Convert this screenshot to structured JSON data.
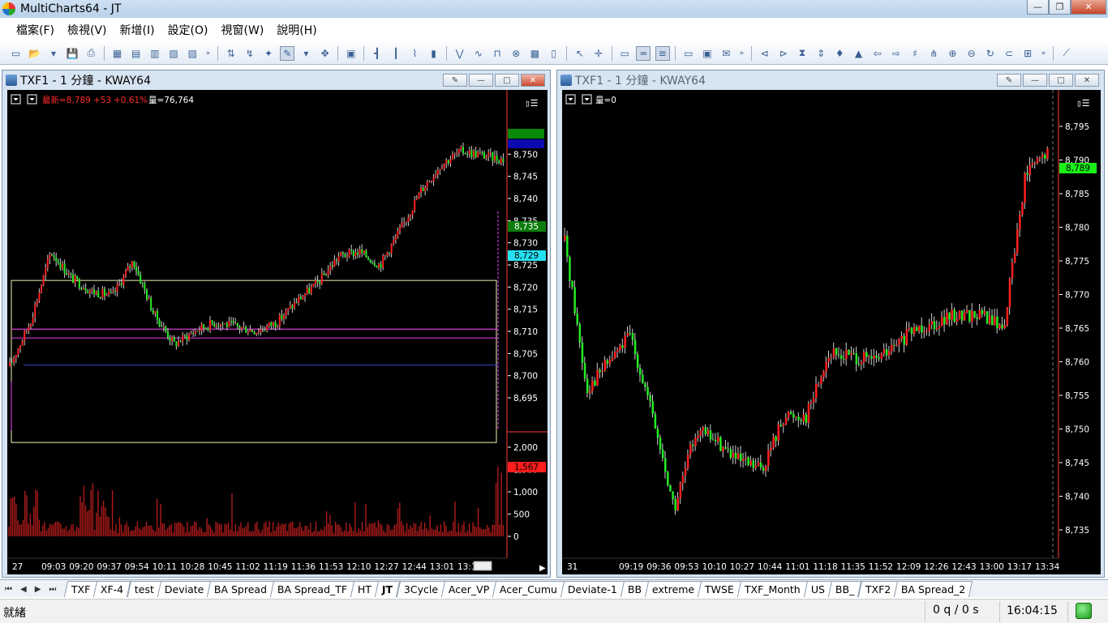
{
  "window": {
    "title": "MultiCharts64 - JT"
  },
  "menu": [
    "檔案(F)",
    "檢視(V)",
    "新增(I)",
    "設定(O)",
    "視窗(W)",
    "說明(H)"
  ],
  "colors": {
    "up": "#ff2020",
    "down": "#22ee22",
    "bg": "#000000",
    "axis_text": "#ffffff",
    "volume": "#b01b1b"
  },
  "left_chart": {
    "title": "TXF1 - 1 分鐘 - KWAY64",
    "status_label": "最新=8,789",
    "status_change": "+53",
    "status_pct": "+0.61%",
    "status_volume": "量=76,764",
    "price_ticks": [
      "8,755",
      "8,750",
      "8,745",
      "8,740",
      "8,735",
      "8,730",
      "8,725",
      "8,720",
      "8,715",
      "8,710",
      "8,705",
      "8,700",
      "8,695"
    ],
    "volume_ticks": [
      "2,000",
      "1,500",
      "1,000",
      "500",
      "0"
    ],
    "time_ticks": [
      "27",
      "09:03",
      "09:20",
      "09:37",
      "09:54",
      "10:11",
      "10:28",
      "10:45",
      "11:02",
      "11:19",
      "11:36",
      "11:53",
      "12:10",
      "12:27",
      "12:44",
      "13:01",
      "13:18"
    ],
    "tags": {
      "green": "8,735",
      "cyan": "8,729",
      "volume": "1,567"
    }
  },
  "right_chart": {
    "title": "TXF1 - 1 分鐘 - KWAY64",
    "status_volume": "量=0",
    "price_ticks": [
      "8,795",
      "8,790",
      "8,785",
      "8,780",
      "8,775",
      "8,770",
      "8,765",
      "8,760",
      "8,755",
      "8,750",
      "8,745",
      "8,740",
      "8,735"
    ],
    "time_ticks": [
      "31",
      "09:19",
      "09:36",
      "09:53",
      "10:10",
      "10:27",
      "10:44",
      "11:01",
      "11:18",
      "11:35",
      "11:52",
      "12:09",
      "12:26",
      "12:43",
      "13:00",
      "13:17",
      "13:34"
    ],
    "tags": {
      "last": "8,789"
    }
  },
  "chart_data": [
    {
      "type": "candlestick",
      "title": "TXF1 - 1 分鐘 - KWAY64",
      "ylim": [
        8692,
        8757
      ],
      "volume_ylim": [
        0,
        2200
      ],
      "x": [
        "27",
        "09:03",
        "09:20",
        "09:37",
        "09:54",
        "10:11",
        "10:28",
        "10:45",
        "11:02",
        "11:19",
        "11:36",
        "11:53",
        "12:10",
        "12:27",
        "12:44",
        "13:01",
        "13:18"
      ],
      "close_path": [
        8702,
        8712,
        8728,
        8722,
        8719,
        8718,
        8726,
        8714,
        8707,
        8710,
        8712,
        8711,
        8710,
        8712,
        8717,
        8721,
        8727,
        8728,
        8725,
        8733,
        8742,
        8748,
        8751,
        8750,
        8749
      ]
    },
    {
      "type": "candlestick",
      "title": "TXF1 - 1 分鐘 - KWAY64",
      "ylim": [
        8732,
        8798
      ],
      "x": [
        "31",
        "09:19",
        "09:36",
        "09:53",
        "10:10",
        "10:27",
        "10:44",
        "11:01",
        "11:18",
        "11:35",
        "11:52",
        "12:09",
        "12:26",
        "12:43",
        "13:00",
        "13:17",
        "13:34"
      ],
      "close_path": [
        8778,
        8756,
        8760,
        8764,
        8752,
        8738,
        8750,
        8748,
        8745,
        8744,
        8752,
        8752,
        8761,
        8761,
        8760,
        8762,
        8765,
        8766,
        8767,
        8767,
        8765,
        8788,
        8791
      ]
    }
  ],
  "sheet_tabs": [
    "TXF",
    "XF-4",
    "test",
    "Deviate",
    "BA Spread",
    "BA Spread_TF",
    "HT",
    "JT",
    "3Cycle",
    "Acer_VP",
    "Acer_Cumu",
    "Deviate-1",
    "BB",
    "extreme",
    "TWSE",
    "TXF_Month",
    "US",
    "BB_",
    "TXF2",
    "BA Spread_2"
  ],
  "active_tab": "JT",
  "status": {
    "text": "就緒",
    "queue": "0 q / 0 s",
    "time": "16:04:15"
  }
}
